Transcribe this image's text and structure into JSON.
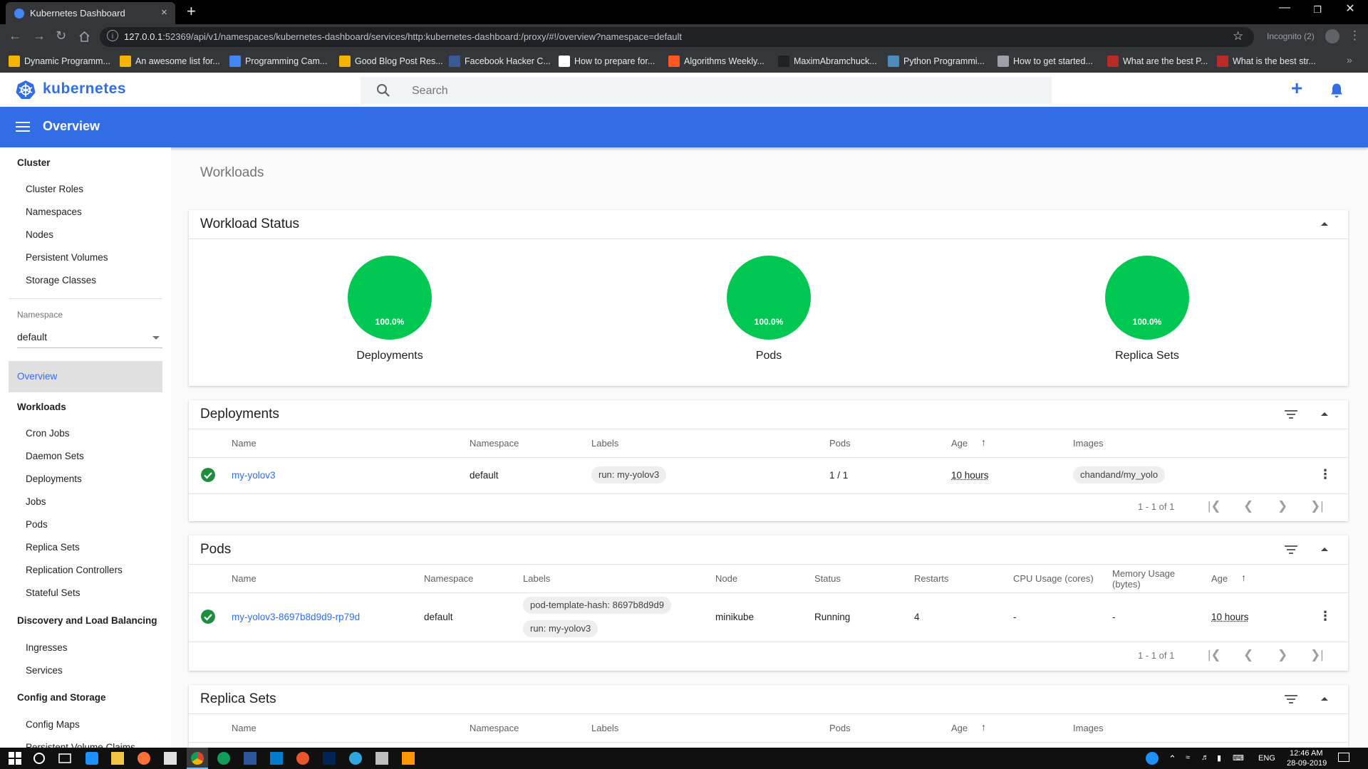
{
  "browser": {
    "tab_title": "Kubernetes Dashboard",
    "tab_close": "×",
    "new_tab": "+",
    "url_host": "127.0.0.1",
    "url_rest": ":52369/api/v1/namespaces/kubernetes-dashboard/services/http:kubernetes-dashboard:/proxy/#!/overview?namespace=default",
    "incognito": "Incognito (2)",
    "bookmarks": [
      {
        "label": "Dynamic Programm...",
        "color": "#f4b400"
      },
      {
        "label": "An awesome list for...",
        "color": "#f4b400"
      },
      {
        "label": "Programming Cam...",
        "color": "#4285f4"
      },
      {
        "label": "Good Blog Post Res...",
        "color": "#f4b400"
      },
      {
        "label": "Facebook Hacker C...",
        "color": "#3b5998"
      },
      {
        "label": "How to prepare for...",
        "color": "#ffffff"
      },
      {
        "label": "Algorithms Weekly...",
        "color": "#ff5722"
      },
      {
        "label": "MaximAbramchuck...",
        "color": "#202124"
      },
      {
        "label": "Python Programmi...",
        "color": "#4b8bbe"
      },
      {
        "label": "How to get started...",
        "color": "#9aa0a6"
      },
      {
        "label": "What are the best P...",
        "color": "#b92b27"
      },
      {
        "label": "What is the best str...",
        "color": "#b92b27"
      }
    ]
  },
  "app": {
    "logo_text": "kubernetes",
    "search_placeholder": "Search",
    "plus_label": "+",
    "page_title": "Overview",
    "accent": "#326de6"
  },
  "sidebar": {
    "cluster_heading": "Cluster",
    "cluster_items": [
      "Cluster Roles",
      "Namespaces",
      "Nodes",
      "Persistent Volumes",
      "Storage Classes"
    ],
    "namespace_label": "Namespace",
    "namespace_value": "default",
    "overview": "Overview",
    "workloads_heading": "Workloads",
    "workloads_items": [
      "Cron Jobs",
      "Daemon Sets",
      "Deployments",
      "Jobs",
      "Pods",
      "Replica Sets",
      "Replication Controllers",
      "Stateful Sets"
    ],
    "discovery_heading": "Discovery and Load Balancing",
    "discovery_items": [
      "Ingresses",
      "Services"
    ],
    "config_heading": "Config and Storage",
    "config_items": [
      "Config Maps",
      "Persistent Volume Claims"
    ]
  },
  "main": {
    "breadcrumb": "Workloads",
    "workload_status": {
      "title": "Workload Status",
      "items": [
        {
          "percent": 100.0,
          "value_label": "100.0%",
          "label": "Deployments"
        },
        {
          "percent": 100.0,
          "value_label": "100.0%",
          "label": "Pods"
        },
        {
          "percent": 100.0,
          "value_label": "100.0%",
          "label": "Replica Sets"
        }
      ]
    },
    "deployments": {
      "title": "Deployments",
      "headers": [
        "Name",
        "Namespace",
        "Labels",
        "Pods",
        "Age",
        "Images"
      ],
      "sort_arrow": "↑",
      "rows": [
        {
          "name": "my-yolov3",
          "namespace": "default",
          "labels": [
            "run: my-yolov3"
          ],
          "pods": "1 / 1",
          "age": "10 hours",
          "images": [
            "chandand/my_yolo"
          ]
        }
      ],
      "pager": "1 - 1 of 1"
    },
    "pods": {
      "title": "Pods",
      "headers": [
        "Name",
        "Namespace",
        "Labels",
        "Node",
        "Status",
        "Restarts",
        "CPU Usage (cores)",
        "Memory Usage",
        "(bytes)",
        "Age"
      ],
      "sort_arrow": "↑",
      "rows": [
        {
          "name": "my-yolov3-8697b8d9d9-rp79d",
          "namespace": "default",
          "labels": [
            "pod-template-hash: 8697b8d9d9",
            "run: my-yolov3"
          ],
          "node": "minikube",
          "status": "Running",
          "restarts": "4",
          "cpu": "-",
          "memory": "-",
          "age": "10 hours"
        }
      ],
      "pager": "1 - 1 of 1"
    },
    "replica_sets": {
      "title": "Replica Sets",
      "headers": [
        "Name",
        "Namespace",
        "Labels",
        "Pods",
        "Age",
        "Images"
      ],
      "sort_arrow": "↑"
    }
  },
  "taskbar": {
    "lang": "ENG",
    "time": "12:46 AM",
    "date": "28-09-2019"
  }
}
